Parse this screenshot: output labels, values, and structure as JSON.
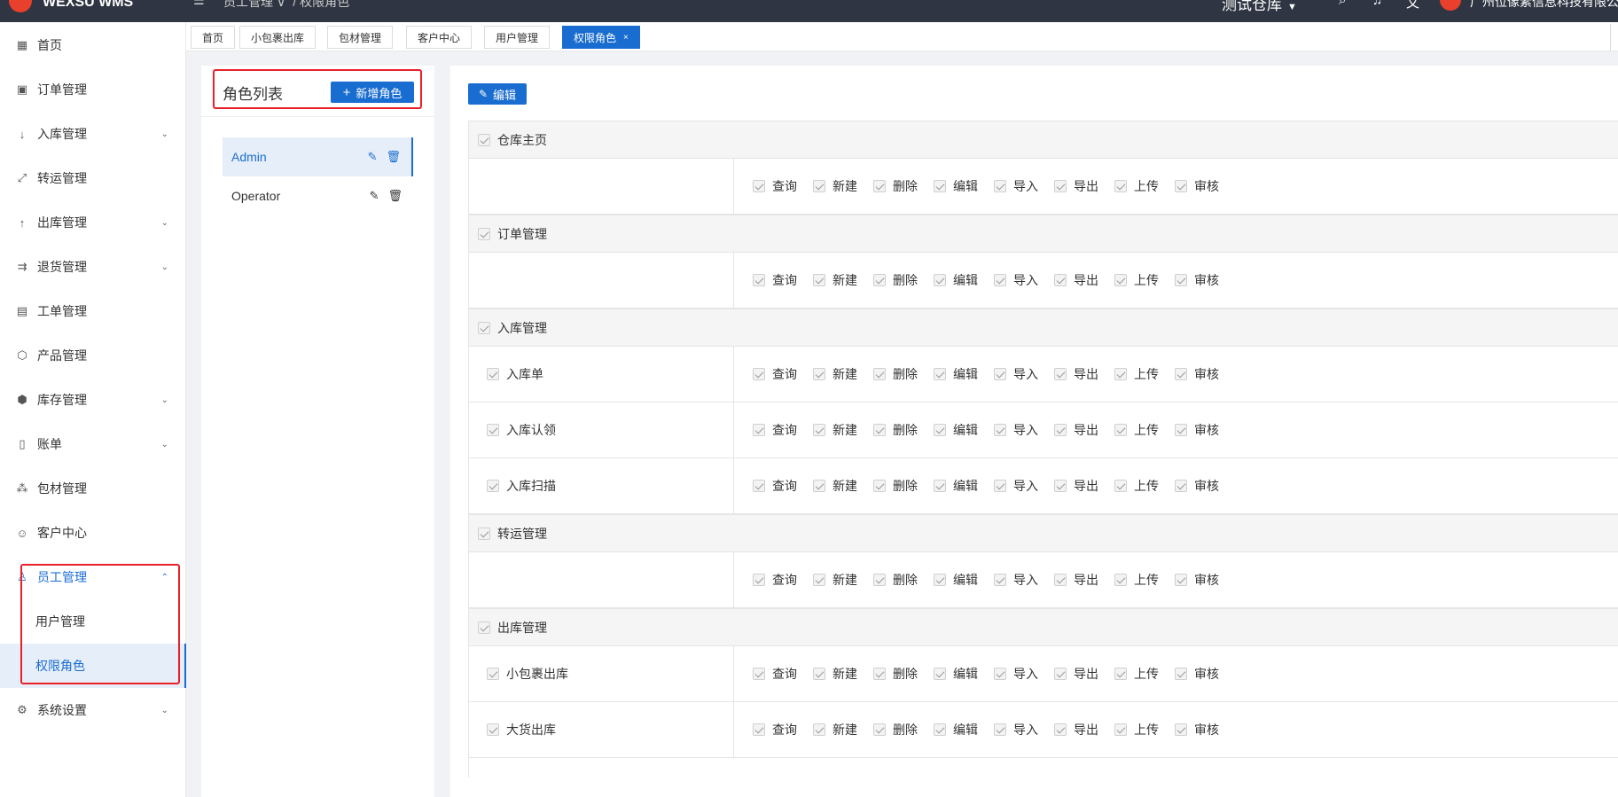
{
  "header": {
    "logo_text": "WEXSU WMS",
    "menu_icon": "menu-fold-icon",
    "breadcrumb": [
      "员工管理",
      "权限角色"
    ],
    "warehouse": "测试仓库",
    "company": "广州位像素信息科技有限公"
  },
  "sidebar": {
    "items": [
      {
        "label": "首页",
        "icon": "dashboard-icon"
      },
      {
        "label": "订单管理",
        "icon": "order-icon"
      },
      {
        "label": "入库管理",
        "icon": "inbound-icon"
      },
      {
        "label": "转运管理",
        "icon": "transfer-icon"
      },
      {
        "label": "出库管理",
        "icon": "outbound-icon"
      },
      {
        "label": "退货管理",
        "icon": "return-icon"
      },
      {
        "label": "工单管理",
        "icon": "workorder-icon"
      },
      {
        "label": "产品管理",
        "icon": "product-icon"
      },
      {
        "label": "库存管理",
        "icon": "inventory-icon"
      },
      {
        "label": "账单",
        "icon": "bill-icon"
      },
      {
        "label": "包材管理",
        "icon": "package-icon"
      },
      {
        "label": "客户中心",
        "icon": "customer-icon"
      },
      {
        "label": "员工管理",
        "icon": "user-icon"
      },
      {
        "label": "系统设置",
        "icon": "gear-icon"
      }
    ],
    "sub_items": [
      "用户管理",
      "权限角色"
    ]
  },
  "tabs": [
    {
      "label": "首页"
    },
    {
      "label": "小包裹出库"
    },
    {
      "label": "包材管理"
    },
    {
      "label": "客户中心"
    },
    {
      "label": "用户管理"
    },
    {
      "label": "权限角色",
      "active": true
    }
  ],
  "roles": {
    "title": "角色列表",
    "add_label": "新增角色",
    "items": [
      "Admin",
      "Operator"
    ]
  },
  "permissions": {
    "edit_label": "编辑",
    "ops": [
      "查询",
      "新建",
      "删除",
      "编辑",
      "导入",
      "导出",
      "上传",
      "审核"
    ],
    "groups": [
      {
        "label": "仓库主页",
        "rows": [
          ""
        ]
      },
      {
        "label": "订单管理",
        "rows": [
          ""
        ]
      },
      {
        "label": "入库管理",
        "rows": [
          "入库单",
          "入库认领",
          "入库扫描"
        ]
      },
      {
        "label": "转运管理",
        "rows": [
          ""
        ]
      },
      {
        "label": "出库管理",
        "rows": [
          "小包裹出库",
          "大货出库"
        ]
      }
    ]
  },
  "colors": {
    "accent": "#1a6dd0",
    "highlight": "#e8202a",
    "topbar": "#2f3542"
  }
}
